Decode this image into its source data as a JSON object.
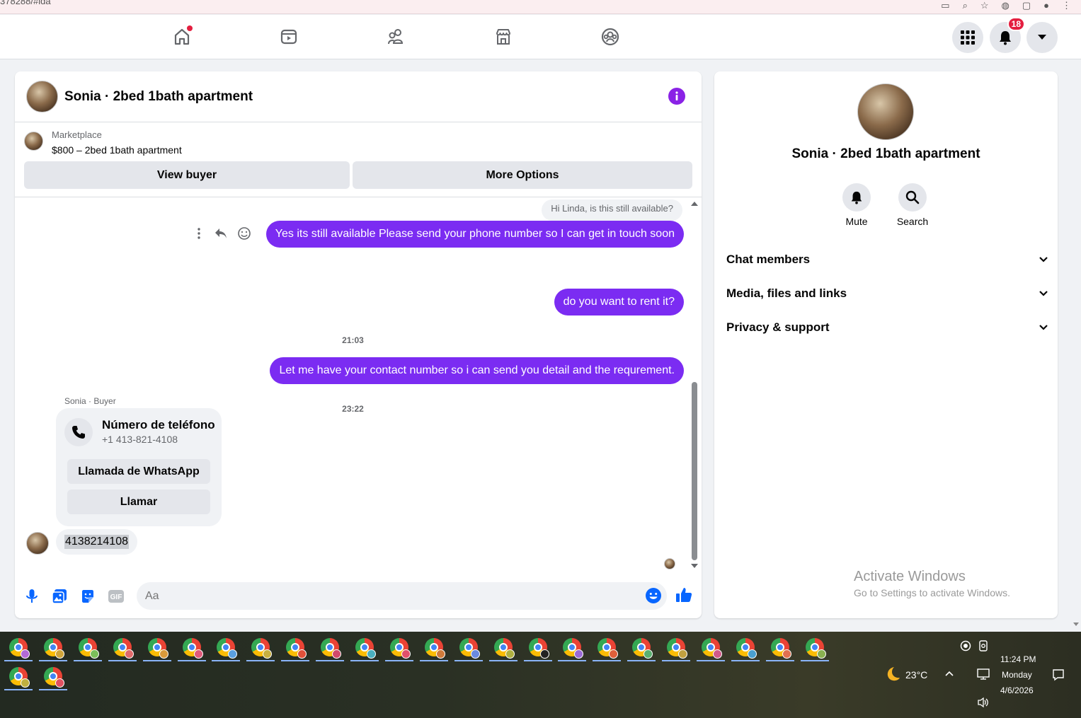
{
  "browser": {
    "url_fragment": "378288/#ida"
  },
  "topnav": {
    "notification_count": "18"
  },
  "chat": {
    "title": "Sonia · 2bed 1bath apartment",
    "marketplace_label": "Marketplace",
    "listing": "$800 – 2bed 1bath apartment",
    "view_buyer": "View buyer",
    "more_options": "More Options",
    "messages": {
      "quoted": "Hi Linda, is this still available?",
      "m1": "Yes its still available Please send your phone number so I can get in touch soon",
      "t1": "21:03",
      "m2": "do you want to rent it?",
      "t2": "23:22",
      "m3": "Let me have your contact number so i can send you detail and the requrement.",
      "sender": "Sonia · Buyer",
      "card_title": "Número de teléfono",
      "card_number": "+1 413-821-4108",
      "card_whatsapp": "Llamada de WhatsApp",
      "card_call": "Llamar",
      "incoming": "4138214108"
    },
    "composer": {
      "placeholder": "Aa",
      "gif": "GIF"
    }
  },
  "info": {
    "title": "Sonia · 2bed 1bath apartment",
    "mute": "Mute",
    "search": "Search",
    "sections": [
      "Chat members",
      "Media, files and links",
      "Privacy & support"
    ],
    "activate_line1": "Activate Windows",
    "activate_line2": "Go to Settings to activate Windows."
  },
  "taskbar": {
    "temperature": "23°C",
    "time": "11:24 PM",
    "day": "Monday",
    "date": "4/6/2026",
    "profile_colors": [
      "#b36ad6",
      "#d0a43a",
      "#7bbf5a",
      "#e06a6a",
      "#d99a3a",
      "#e05a7a",
      "#5aa0e0",
      "#c8b040",
      "#e0503a",
      "#d04a6a",
      "#4ab0c0",
      "#e0506a",
      "#d07a3a",
      "#6a8ae0",
      "#b0b040",
      "#222222",
      "#9a6ad6",
      "#e0603a",
      "#5ab070",
      "#c0a040",
      "#d05a8a",
      "#4aa0d0",
      "#e07050",
      "#8ab050",
      "#c0b040",
      "#e05060"
    ]
  },
  "accent": {
    "messenger_purple": "#7b2cf2",
    "fb_blue": "#0866ff"
  }
}
